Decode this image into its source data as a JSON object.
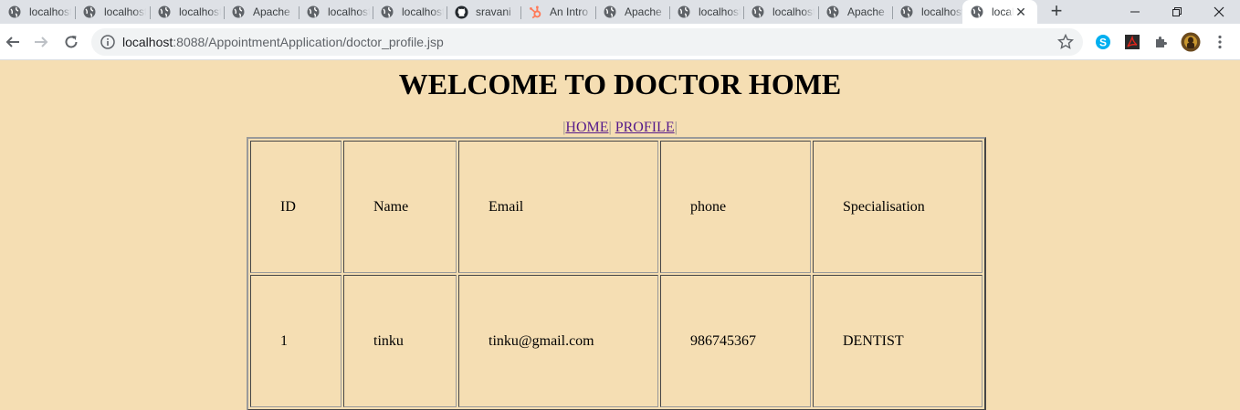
{
  "browser": {
    "tabs": [
      {
        "title": "localhost",
        "icon": "globe-icon"
      },
      {
        "title": "localhost",
        "icon": "globe-icon"
      },
      {
        "title": "localhost",
        "icon": "globe-icon"
      },
      {
        "title": "Apache",
        "icon": "globe-icon"
      },
      {
        "title": "localhost",
        "icon": "globe-icon"
      },
      {
        "title": "localhost",
        "icon": "globe-icon"
      },
      {
        "title": "sravani",
        "icon": "github-icon"
      },
      {
        "title": "An Intro",
        "icon": "hubspot-icon"
      },
      {
        "title": "Apache",
        "icon": "globe-icon"
      },
      {
        "title": "localhost",
        "icon": "globe-icon"
      },
      {
        "title": "localhost",
        "icon": "globe-icon"
      },
      {
        "title": "Apache",
        "icon": "globe-icon"
      },
      {
        "title": "localhost",
        "icon": "globe-icon"
      },
      {
        "title": "localhost",
        "icon": "globe-icon",
        "active": true
      }
    ],
    "url_host": "localhost",
    "url_path": ":8088/AppointmentApplication/doctor_profile.jsp",
    "extensions": [
      "skype-icon",
      "pdf-icon",
      "extensions-puzzle-icon",
      "profile-avatar"
    ],
    "colors": {
      "tabstrip": "#dee1e6",
      "page_bg": "#f5deb3",
      "link": "#551a8b"
    }
  },
  "page": {
    "heading": "WELCOME TO DOCTOR HOME",
    "nav": {
      "pipe": "|",
      "home": "HOME",
      "profile": "PROFILE"
    },
    "table": {
      "headers": [
        "ID",
        "Name",
        "Email",
        "phone",
        "Specialisation"
      ],
      "rows": [
        [
          "1",
          "tinku",
          "tinku@gmail.com",
          "986745367",
          "DENTIST"
        ]
      ]
    }
  }
}
